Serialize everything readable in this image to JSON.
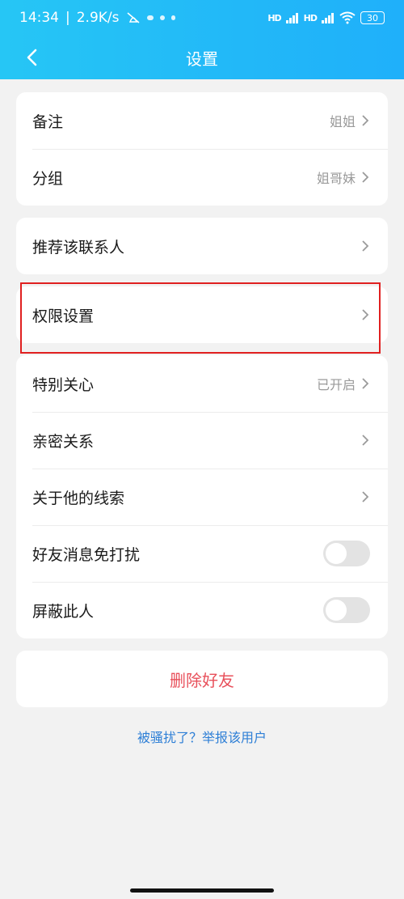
{
  "status_bar": {
    "time": "14:34",
    "net_speed": "2.9K/s",
    "signal1": "HD",
    "signal2": "HD",
    "battery": "30"
  },
  "header": {
    "title": "设置",
    "back_icon": "chevron-left-icon"
  },
  "group1": [
    {
      "label": "备注",
      "value": "姐姐"
    },
    {
      "label": "分组",
      "value": "姐哥妹"
    }
  ],
  "group2": [
    {
      "label": "推荐该联系人",
      "value": ""
    }
  ],
  "group3": [
    {
      "label": "权限设置",
      "value": ""
    }
  ],
  "group4": [
    {
      "label": "特别关心",
      "value": "已开启",
      "type": "link"
    },
    {
      "label": "亲密关系",
      "value": "",
      "type": "link"
    },
    {
      "label": "关于他的线索",
      "value": "",
      "type": "link"
    },
    {
      "label": "好友消息免打扰",
      "type": "toggle",
      "on": false
    },
    {
      "label": "屏蔽此人",
      "type": "toggle",
      "on": false
    }
  ],
  "delete_button": "删除好友",
  "report_link": "被骚扰了？举报该用户",
  "colors": {
    "header": "#22b8f8",
    "delete": "#e8505b",
    "link": "#2e7fd6",
    "highlight": "#e02020"
  }
}
